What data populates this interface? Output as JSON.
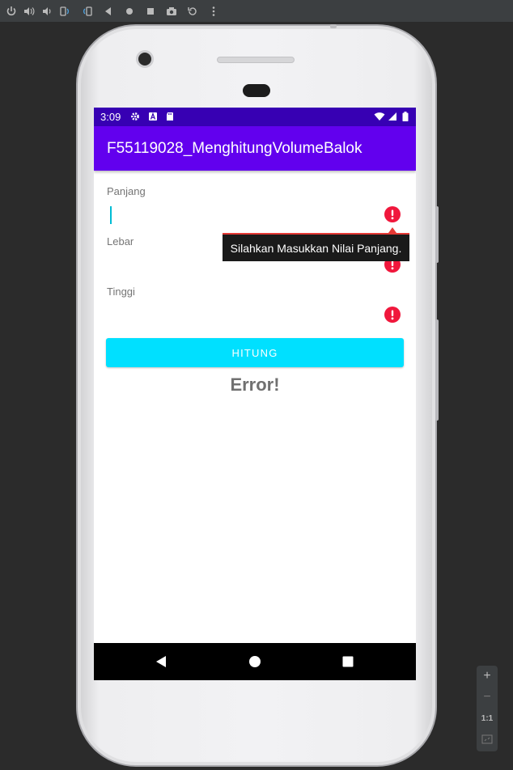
{
  "emulator_toolbar": {
    "icons": [
      "power-icon",
      "volume-up-icon",
      "volume-down-icon",
      "rotate-left-icon",
      "rotate-right-icon",
      "back-icon",
      "home-icon",
      "overview-icon",
      "screenshot-icon",
      "replay-icon",
      "more-icon"
    ]
  },
  "status_bar": {
    "time": "3:09",
    "icons": [
      "settings-icon",
      "font-icon",
      "sd-card-icon",
      "wifi-icon",
      "signal-icon",
      "battery-icon"
    ]
  },
  "app_bar": {
    "title": "F55119028_MenghitungVolumeBalok"
  },
  "form": {
    "panjang": {
      "label": "Panjang",
      "value": ""
    },
    "lebar": {
      "label": "Lebar",
      "value": ""
    },
    "tinggi": {
      "label": "Tinggi",
      "value": ""
    },
    "error_tooltip": "Silahkan Masukkan Nilai Panjang."
  },
  "button": {
    "label": "HITUNG"
  },
  "result": {
    "text": "Error!"
  },
  "zoom_controls": {
    "zoom_in": "+",
    "zoom_out": "−",
    "actual_size": "1:1"
  },
  "colors": {
    "status_bar": "#3700b3",
    "app_bar": "#6200ee",
    "accent": "#00bcd4",
    "button": "#00e0ff",
    "error": "#f0173c"
  }
}
